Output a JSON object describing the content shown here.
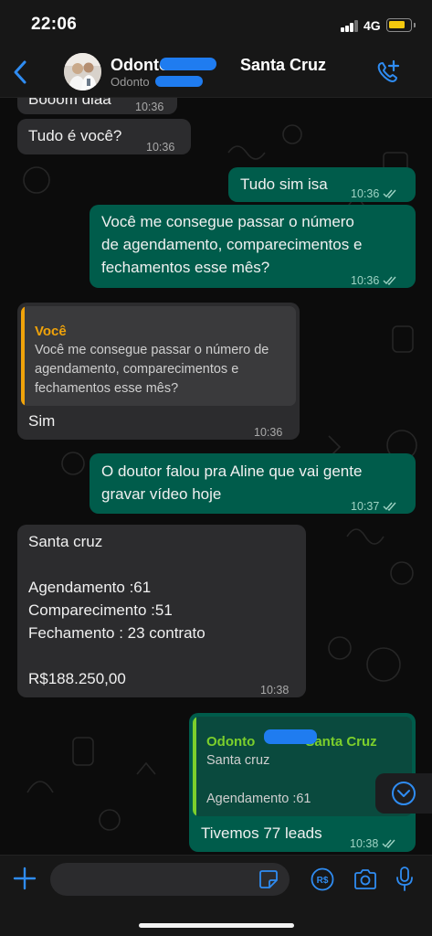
{
  "status_bar": {
    "time": "22:06",
    "network": "4G"
  },
  "header": {
    "contact_name_start": "Odonto",
    "contact_name_end": "Santa Cruz",
    "contact_sub": "Odonto"
  },
  "messages": [
    {
      "text": "Booom diaa",
      "time": "10:36"
    },
    {
      "text": "Tudo é você?",
      "time": "10:36"
    },
    {
      "text": "Tudo sim isa",
      "time": "10:36"
    },
    {
      "lines": [
        "Você me consegue passar o número",
        "de agendamento, comparecimentos e",
        "fechamentos esse mês?"
      ],
      "time": "10:36"
    },
    {
      "quote_author": "Você",
      "quote_lines": [
        "Você me consegue passar o número de",
        "agendamento, comparecimentos e",
        "fechamentos esse mês?"
      ],
      "text": "Sim",
      "time": "10:36"
    },
    {
      "lines": [
        "O doutor falou pra Aline que vai gente",
        "gravar vídeo hoje"
      ],
      "time": "10:37"
    },
    {
      "lines": [
        "Santa cruz",
        "",
        "Agendamento :61",
        "Comparecimento :51",
        "Fechamento : 23 contrato",
        "",
        "R$188.250,00"
      ],
      "time": "10:38"
    },
    {
      "quote_author_start": "Odonto",
      "quote_author_end": "Santa Cruz",
      "quote_lines": [
        "Santa cruz",
        "",
        "Agendamento :61"
      ],
      "text": "Tivemos 77 leads",
      "time": "10:38"
    }
  ],
  "input": {
    "placeholder": "",
    "value": ""
  },
  "colors": {
    "incoming_bubble": "#2c2c2e",
    "outgoing_bubble": "#005c4b",
    "accent_blue": "#1e88e5",
    "quote_you": "#f0a30a",
    "quote_contact": "#7ccf2c"
  },
  "icons": [
    "back-icon",
    "add-call-icon",
    "plus-icon",
    "sticker-icon",
    "payment-icon",
    "camera-icon",
    "microphone-icon",
    "chevron-down-icon"
  ]
}
